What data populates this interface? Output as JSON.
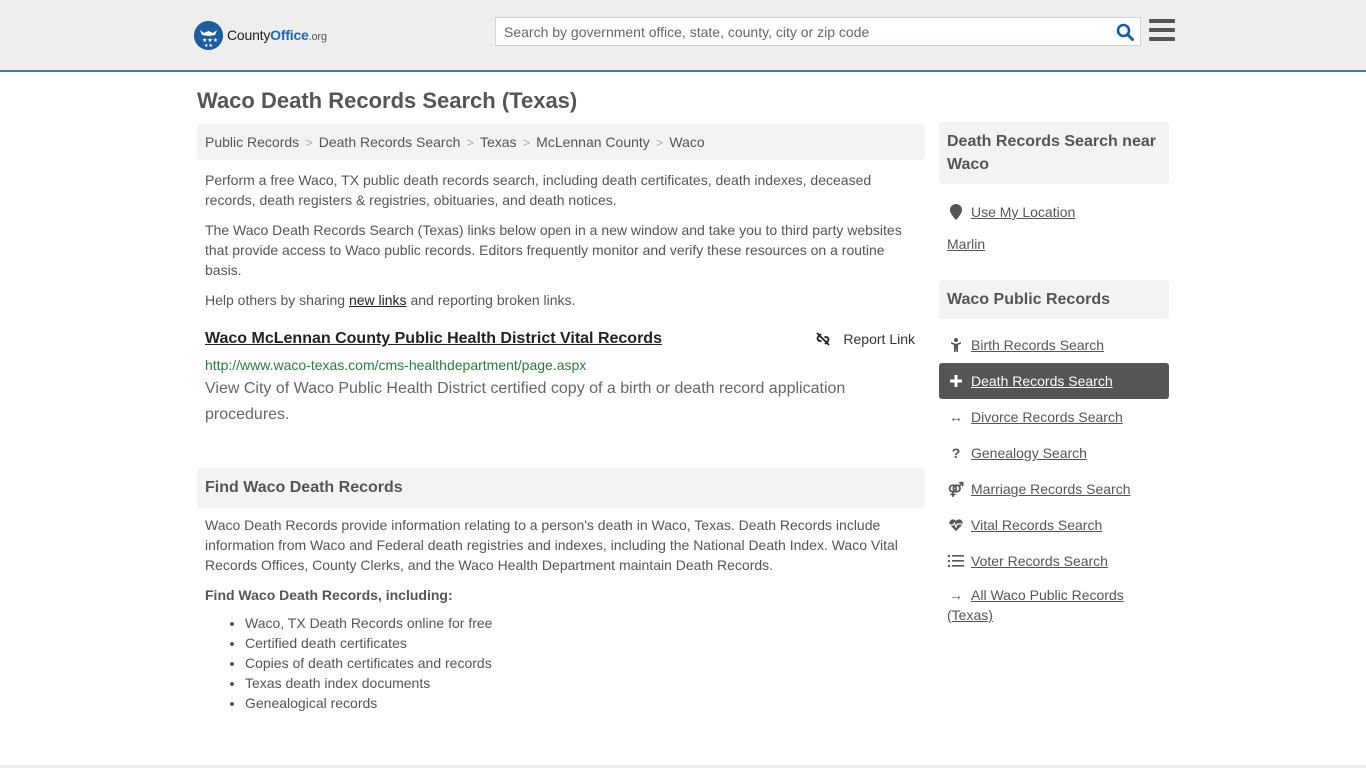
{
  "header": {
    "logo": {
      "part1": "County",
      "part2": "Office",
      "part3": ".org"
    },
    "search": {
      "placeholder": "Search by government office, state, county, city or zip code",
      "value": ""
    },
    "icons": {
      "search": "search-icon",
      "menu": "hamburger-menu-icon"
    }
  },
  "page": {
    "title": "Waco Death Records Search (Texas)",
    "breadcrumb": [
      "Public Records",
      "Death Records Search",
      "Texas",
      "McLennan County",
      "Waco"
    ],
    "breadcrumb_separator": ">"
  },
  "intro": {
    "p1": "Perform a free Waco, TX public death records search, including death certificates, death indexes, deceased records, death registers & registries, obituaries, and death notices.",
    "p2": "The Waco Death Records Search (Texas) links below open in a new window and take you to third party websites that provide access to Waco public records. Editors frequently monitor and verify these resources on a routine basis.",
    "p3_before": "Help others by sharing ",
    "p3_link": "new links",
    "p3_after": " and reporting broken links."
  },
  "listing": {
    "title": "Waco McLennan County Public Health District Vital Records",
    "report_label": "Report Link",
    "url": "http://www.waco-texas.com/cms-healthdepartment/page.aspx",
    "description": "View City of Waco Public Health District certified copy of a birth or death record application procedures."
  },
  "find_section": {
    "heading": "Find Waco Death Records",
    "body": "Waco Death Records provide information relating to a person's death in Waco, Texas. Death Records include information from Waco and Federal death registries and indexes, including the National Death Index. Waco Vital Records Offices, County Clerks, and the Waco Health Department maintain Death Records.",
    "subheading": "Find Waco Death Records, including:",
    "items": [
      "Waco, TX Death Records online for free",
      "Certified death certificates",
      "Copies of death certificates and records",
      "Texas death index documents",
      "Genealogical records"
    ]
  },
  "sidebar": {
    "near": {
      "heading": "Death Records Search near Waco",
      "use_location": "Use My Location",
      "places": [
        "Marlin"
      ]
    },
    "public_records": {
      "heading": "Waco Public Records",
      "items": [
        {
          "label": "Birth Records Search",
          "icon": "baby-icon",
          "active": false
        },
        {
          "label": "Death Records Search",
          "icon": "plus-icon",
          "active": true
        },
        {
          "label": "Divorce Records Search",
          "icon": "arrows-horizontal-icon",
          "active": false
        },
        {
          "label": "Genealogy Search",
          "icon": "question-icon",
          "active": false
        },
        {
          "label": "Marriage Records Search",
          "icon": "venus-mars-icon",
          "active": false
        },
        {
          "label": "Vital Records Search",
          "icon": "heartbeat-icon",
          "active": false
        },
        {
          "label": "Voter Records Search",
          "icon": "list-ol-icon",
          "active": false
        }
      ],
      "all_link": "All Waco Public Records (Texas)"
    }
  },
  "colors": {
    "brand_blue": "#1c67b5",
    "header_border": "#3b7bb3",
    "url_green": "#2c7a3f",
    "active_bg": "#555555",
    "panel_bg": "#f3f3f3"
  }
}
